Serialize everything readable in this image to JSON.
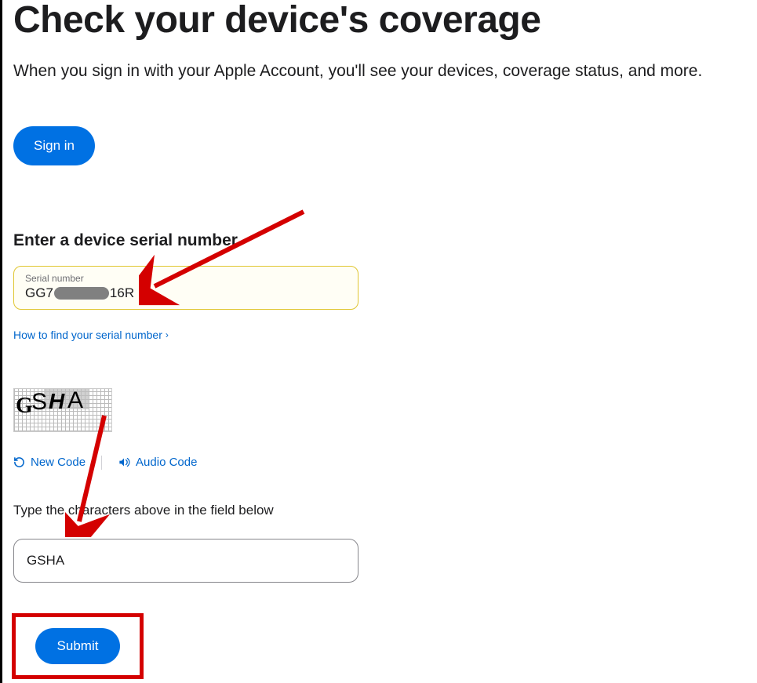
{
  "header": {
    "title": "Check your device's coverage",
    "subtitle": "When you sign in with your Apple Account, you'll see your devices, coverage status, and more."
  },
  "signin": {
    "label": "Sign in"
  },
  "serial": {
    "heading": "Enter a device serial number",
    "floating_label": "Serial number",
    "value_prefix": "GG7",
    "value_suffix": "16R",
    "help_link": "How to find your serial number"
  },
  "captcha": {
    "image_text_chars": [
      "G",
      "S",
      "H",
      "A"
    ],
    "new_code": "New Code",
    "audio_code": "Audio Code",
    "instruction": "Type the characters above in the field below",
    "value": "GSHA"
  },
  "submit": {
    "label": "Submit"
  },
  "colors": {
    "accent": "#0071e3",
    "link": "#0066cc",
    "highlight_red": "#d40000",
    "field_border_yellow": "#e0c631"
  },
  "annotations": {
    "arrow1": "points to serial number field",
    "arrow2": "points to captcha input",
    "box": "highlights Submit button"
  }
}
